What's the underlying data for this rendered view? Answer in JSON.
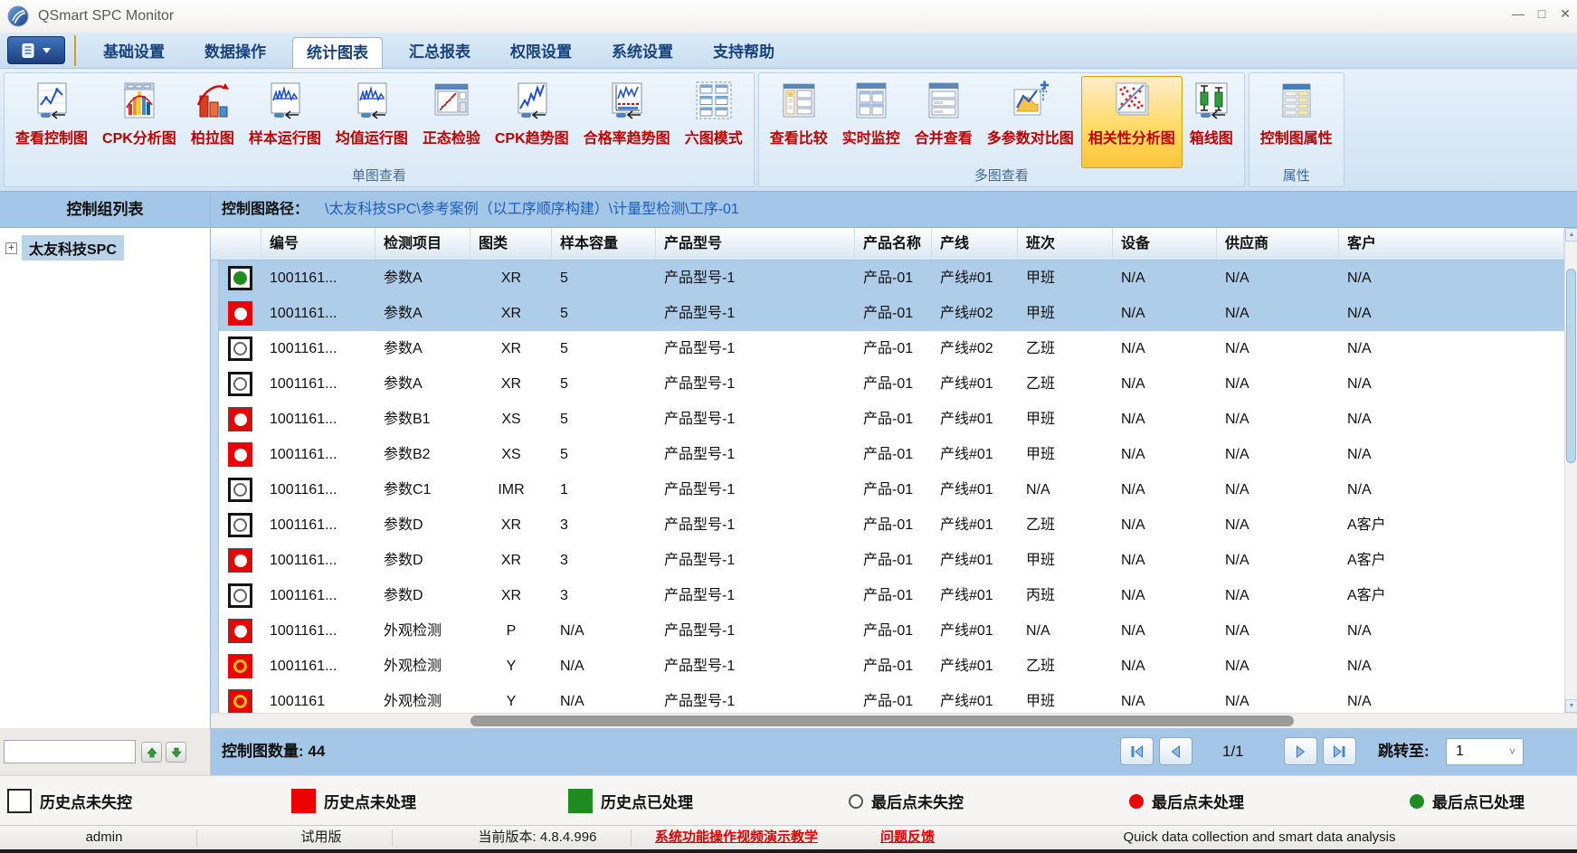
{
  "window": {
    "title": "QSmart SPC Monitor"
  },
  "window_controls": {
    "minimize": "—",
    "maximize": "□",
    "close": "✕"
  },
  "menu": {
    "tabs": [
      "基础设置",
      "数据操作",
      "统计图表",
      "汇总报表",
      "权限设置",
      "系统设置",
      "支持帮助"
    ],
    "active_index": 2
  },
  "ribbon": {
    "groups": [
      {
        "label": "单图查看",
        "buttons": [
          {
            "label": "查看控制图",
            "icon": "control-chart"
          },
          {
            "label": "CPK分析图",
            "icon": "cpk-hist"
          },
          {
            "label": "柏拉图",
            "icon": "pareto"
          },
          {
            "label": "样本运行图",
            "icon": "run-chart"
          },
          {
            "label": "均值运行图",
            "icon": "mean-run-chart"
          },
          {
            "label": "正态检验",
            "icon": "normal-test"
          },
          {
            "label": "CPK趋势图",
            "icon": "cpk-trend"
          },
          {
            "label": "合格率趋势图",
            "icon": "rate-trend"
          },
          {
            "label": "六图模式",
            "icon": "six-grid"
          }
        ]
      },
      {
        "label": "多图查看",
        "buttons": [
          {
            "label": "查看比较",
            "icon": "compare"
          },
          {
            "label": "实时监控",
            "icon": "realtime"
          },
          {
            "label": "合并查看",
            "icon": "merge"
          },
          {
            "label": "多参数对比图",
            "icon": "multi-param"
          },
          {
            "label": "相关性分析图",
            "icon": "correlation",
            "selected": true
          },
          {
            "label": "箱线图",
            "icon": "boxplot"
          }
        ]
      },
      {
        "label": "属性",
        "buttons": [
          {
            "label": "控制图属性",
            "icon": "chart-props"
          }
        ]
      }
    ]
  },
  "sidebar": {
    "header": "控制组列表",
    "tree_root": "太友科技SPC"
  },
  "pathbar": {
    "label": "控制图路径：",
    "path": "\\太友科技SPC\\参考案例（以工序顺序构建）\\计量型检测\\工序-01"
  },
  "table": {
    "columns": [
      "编号",
      "检测项目",
      "图类",
      "样本容量",
      "产品型号",
      "产品名称",
      "产线",
      "班次",
      "设备",
      "供应商",
      "客户"
    ],
    "rows": [
      {
        "status": "green-dot",
        "selected": true,
        "cells": [
          "1001161...",
          "参数A",
          "XR",
          "5",
          "产品型号-1",
          "产品-01",
          "产线#01",
          "甲班",
          "N/A",
          "N/A",
          "N/A"
        ]
      },
      {
        "status": "red-dot",
        "selected": true,
        "cells": [
          "1001161...",
          "参数A",
          "XR",
          "5",
          "产品型号-1",
          "产品-01",
          "产线#02",
          "甲班",
          "N/A",
          "N/A",
          "N/A"
        ]
      },
      {
        "status": "outline",
        "selected": false,
        "cells": [
          "1001161...",
          "参数A",
          "XR",
          "5",
          "产品型号-1",
          "产品-01",
          "产线#02",
          "乙班",
          "N/A",
          "N/A",
          "N/A"
        ]
      },
      {
        "status": "outline",
        "selected": false,
        "cells": [
          "1001161...",
          "参数A",
          "XR",
          "5",
          "产品型号-1",
          "产品-01",
          "产线#01",
          "乙班",
          "N/A",
          "N/A",
          "N/A"
        ]
      },
      {
        "status": "red-dot",
        "selected": false,
        "cells": [
          "1001161...",
          "参数B1",
          "XS",
          "5",
          "产品型号-1",
          "产品-01",
          "产线#01",
          "甲班",
          "N/A",
          "N/A",
          "N/A"
        ]
      },
      {
        "status": "red-dot",
        "selected": false,
        "cells": [
          "1001161...",
          "参数B2",
          "XS",
          "5",
          "产品型号-1",
          "产品-01",
          "产线#01",
          "甲班",
          "N/A",
          "N/A",
          "N/A"
        ]
      },
      {
        "status": "outline",
        "selected": false,
        "cells": [
          "1001161...",
          "参数C1",
          "IMR",
          "1",
          "产品型号-1",
          "产品-01",
          "产线#01",
          "N/A",
          "N/A",
          "N/A",
          "N/A"
        ]
      },
      {
        "status": "outline",
        "selected": false,
        "cells": [
          "1001161...",
          "参数D",
          "XR",
          "3",
          "产品型号-1",
          "产品-01",
          "产线#01",
          "乙班",
          "N/A",
          "N/A",
          "A客户"
        ]
      },
      {
        "status": "red-dot",
        "selected": false,
        "cells": [
          "1001161...",
          "参数D",
          "XR",
          "3",
          "产品型号-1",
          "产品-01",
          "产线#01",
          "甲班",
          "N/A",
          "N/A",
          "A客户"
        ]
      },
      {
        "status": "outline",
        "selected": false,
        "cells": [
          "1001161...",
          "参数D",
          "XR",
          "3",
          "产品型号-1",
          "产品-01",
          "产线#01",
          "丙班",
          "N/A",
          "N/A",
          "A客户"
        ]
      },
      {
        "status": "red-dot",
        "selected": false,
        "cells": [
          "1001161...",
          "外观检测",
          "P",
          "N/A",
          "产品型号-1",
          "产品-01",
          "产线#01",
          "N/A",
          "N/A",
          "N/A",
          "N/A"
        ]
      },
      {
        "status": "red-ring",
        "selected": false,
        "cells": [
          "1001161...",
          "外观检测",
          "Y",
          "N/A",
          "产品型号-1",
          "产品-01",
          "产线#01",
          "乙班",
          "N/A",
          "N/A",
          "N/A"
        ]
      },
      {
        "status": "red-ring",
        "selected": false,
        "cells": [
          "1001161",
          "外观检测",
          "Y",
          "N/A",
          "产品型号-1",
          "产品-01",
          "产线#01",
          "甲班",
          "N/A",
          "N/A",
          "N/A"
        ]
      }
    ]
  },
  "footer": {
    "count_label": "控制图数量:",
    "count_value": "44",
    "page": "1/1",
    "jump_label": "跳转至:",
    "jump_value": "1"
  },
  "legend": {
    "items": [
      {
        "shape": "square-white",
        "label": "历史点未失控"
      },
      {
        "shape": "square-red",
        "label": "历史点未处理"
      },
      {
        "shape": "square-green",
        "label": "历史点已处理"
      },
      {
        "shape": "circle-outline",
        "label": "最后点未失控"
      },
      {
        "shape": "circle-red",
        "label": "最后点未处理"
      },
      {
        "shape": "circle-green",
        "label": "最后点已处理"
      }
    ]
  },
  "statusbar": {
    "items": [
      {
        "label": "admin",
        "link": false
      },
      {
        "label": "试用版",
        "link": false
      },
      {
        "label": "当前版本: 4.8.4.996",
        "link": false
      },
      {
        "label": "系统功能操作视频演示教学",
        "link": true
      },
      {
        "label": "问题反馈",
        "link": true
      },
      {
        "label": "Quick data collection and smart data analysis",
        "link": false
      }
    ]
  },
  "colors": {
    "band_blue": "#a5c7e7",
    "selected_row": "#aecde9",
    "ribbon_selected": "#ffd95e",
    "button_label_red": "#c00000",
    "path_link_blue": "#1b5cbe",
    "status_red": "#ec0000",
    "status_green": "#1f8c1f",
    "status_yellow": "#f2c100"
  }
}
